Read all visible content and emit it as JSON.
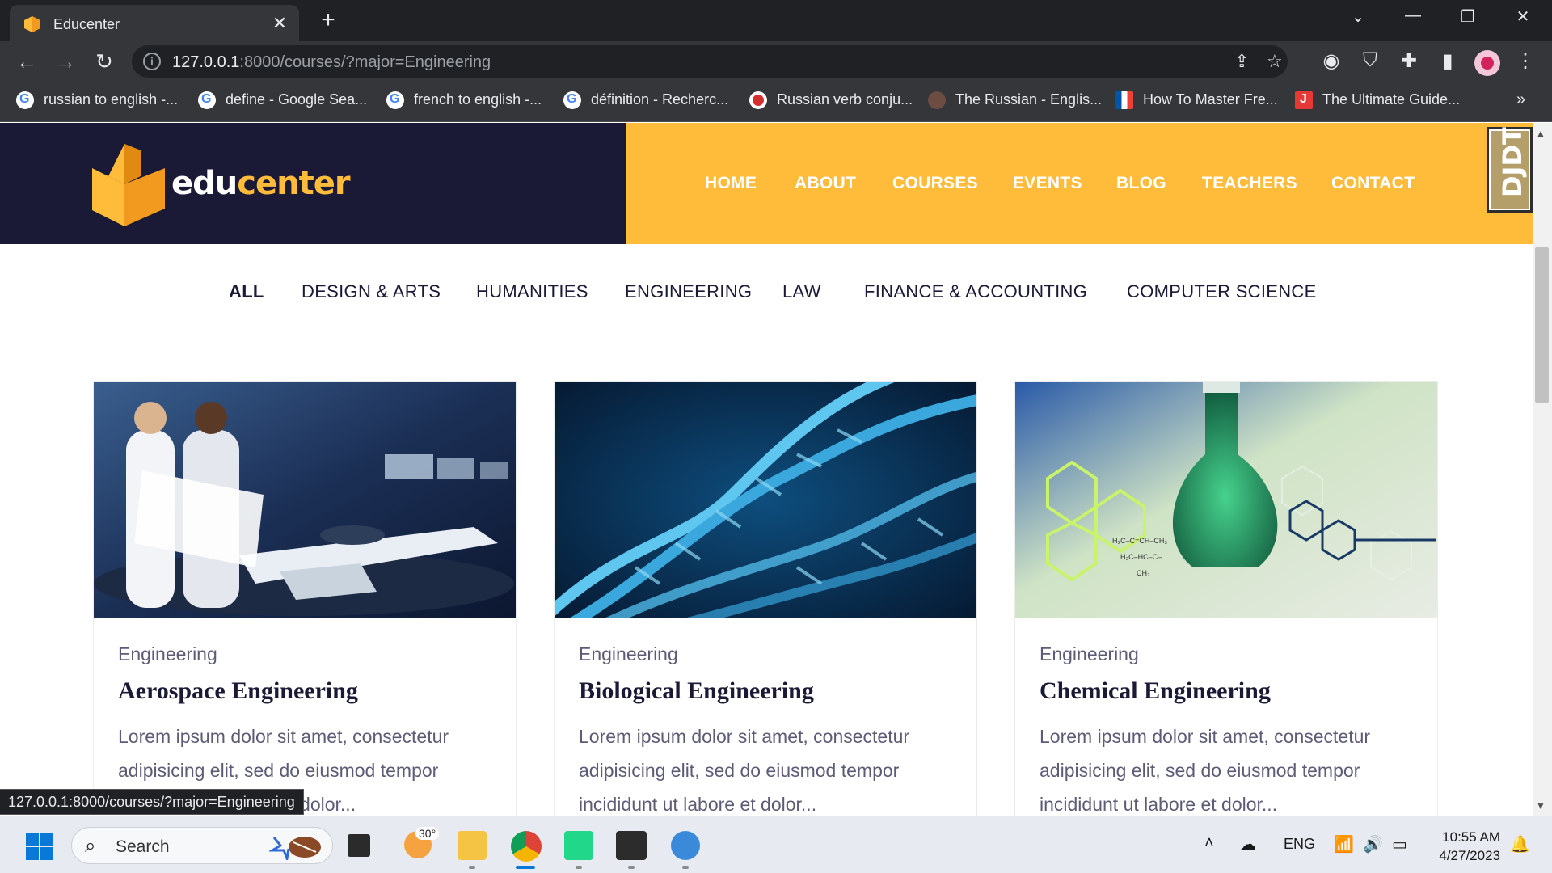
{
  "browser": {
    "tab_title": "Educenter",
    "tab_close": "✕",
    "new_tab": "+",
    "url_host": "127.0.0.1",
    "url_rest": ":8000/courses/?major=Engineering",
    "status_url": "127.0.0.1:8000/courses/?major=Engineering",
    "bookmarks": [
      {
        "label": "russian to english -...",
        "icon": "google-icon"
      },
      {
        "label": "define - Google Sea...",
        "icon": "google-icon"
      },
      {
        "label": "french to english -...",
        "icon": "google-icon"
      },
      {
        "label": "définition - Recherc...",
        "icon": "google-icon"
      },
      {
        "label": "Russian verb conju...",
        "icon": "reverso-icon"
      },
      {
        "label": "The Russian - Englis...",
        "icon": "book-icon"
      },
      {
        "label": "How To Master Fre...",
        "icon": "flag-icon"
      },
      {
        "label": "The Ultimate Guide...",
        "icon": "j-icon"
      }
    ],
    "bookmarks_more": "»"
  },
  "site": {
    "logo_part1": "edu",
    "logo_part2": "center",
    "nav": [
      "HOME",
      "ABOUT",
      "COURSES",
      "EVENTS",
      "BLOG",
      "TEACHERS",
      "CONTACT"
    ],
    "debug_toolbar": "DJDT",
    "brand_colors": {
      "dark": "#1a1a37",
      "accent": "#ffbc3b"
    }
  },
  "filters": {
    "items": [
      "ALL",
      "DESIGN & ARTS",
      "HUMANITIES",
      "ENGINEERING",
      "LAW",
      "FINANCE & ACCOUNTING",
      "COMPUTER SCIENCE"
    ],
    "active": "ALL"
  },
  "courses": [
    {
      "category": "Engineering",
      "title": "Aerospace Engineering",
      "description": "Lorem ipsum dolor sit amet, consectetur adipisicing elit, sed do eiusmod tempor incididunt ut labore et dolor...",
      "image": "aerospace-lab-photo"
    },
    {
      "category": "Engineering",
      "title": "Biological Engineering",
      "description": "Lorem ipsum dolor sit amet, consectetur adipisicing elit, sed do eiusmod tempor incididunt ut labore et dolor...",
      "image": "dna-helix-photo"
    },
    {
      "category": "Engineering",
      "title": "Chemical Engineering",
      "description": "Lorem ipsum dolor sit amet, consectetur adipisicing elit, sed do eiusmod tempor incididunt ut labore et dolor...",
      "image": "chemistry-flask-photo"
    }
  ],
  "taskbar": {
    "search_placeholder": "Search",
    "weather_temp": "30°",
    "lang": "ENG",
    "time": "10:55 AM",
    "date": "4/27/2023"
  }
}
